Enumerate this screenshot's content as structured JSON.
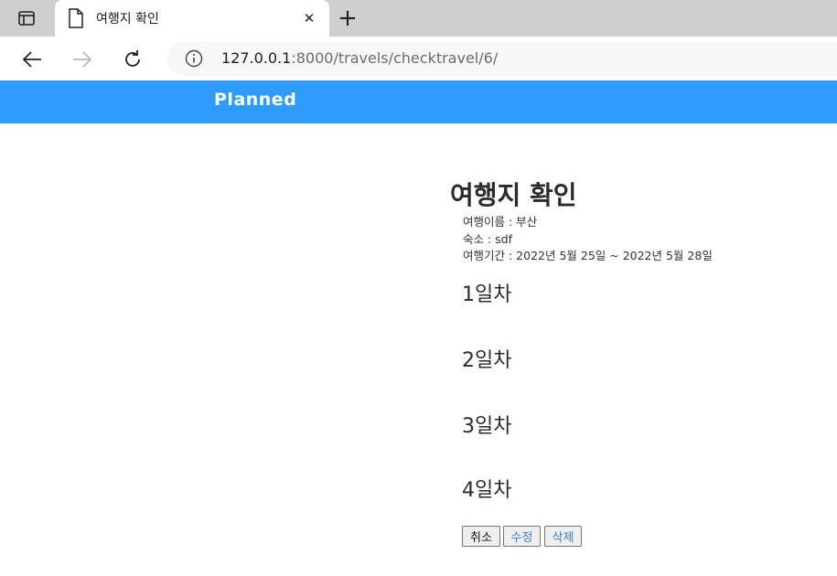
{
  "browser": {
    "tab": {
      "title": "여행지 확인",
      "close_glyph": "✕"
    },
    "new_tab_glyph": "+",
    "address": {
      "host": "127.0.0.1",
      "rest": ":8000/travels/checktravel/6/"
    },
    "icons": {
      "tab_actions": "tab-actions-icon",
      "page": "page-icon",
      "back": "back-arrow-icon",
      "forward": "forward-arrow-icon",
      "reload": "reload-icon",
      "info": "info-icon"
    }
  },
  "header": {
    "brand": "Planned",
    "color": "#2e9bff"
  },
  "main": {
    "title": "여행지 확인",
    "name_line": "여행이름 : 부산",
    "lodging_line": "숙소 : sdf",
    "period_line": "여행기간 : 2022년 5월 25일 ~ 2022년 5월 28일",
    "days": [
      "1일차",
      "2일차",
      "3일차",
      "4일차"
    ],
    "buttons": {
      "cancel": "취소",
      "edit": "수정",
      "delete": "삭제"
    }
  }
}
